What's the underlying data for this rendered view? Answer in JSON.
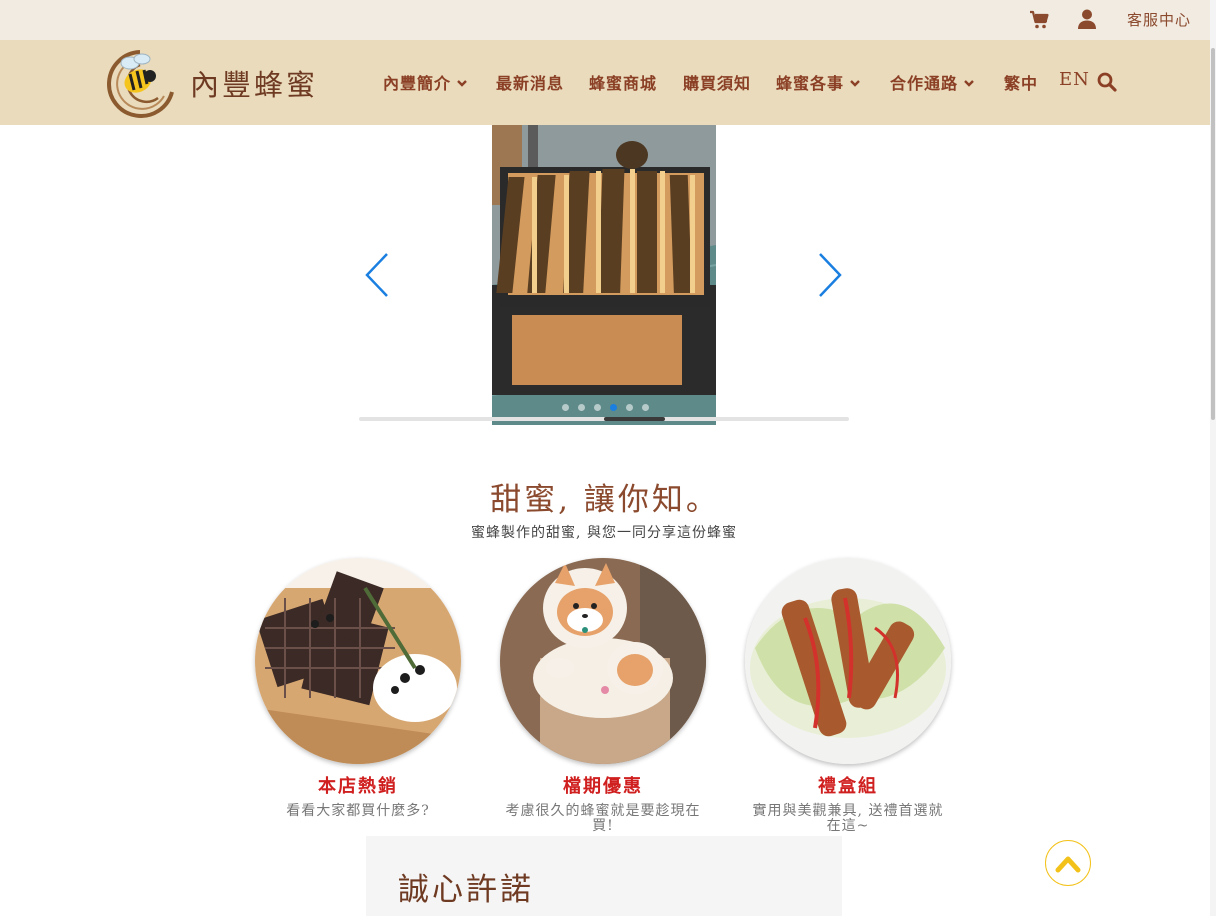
{
  "topbar": {
    "cart_icon": "shopping-cart-icon",
    "user_icon": "user-icon",
    "customer_service_label": "客服中心"
  },
  "brand": {
    "logo_icon": "bee-logo-icon",
    "name": "內豐蜂蜜"
  },
  "nav": {
    "items": [
      {
        "label": "內豐簡介",
        "has_dropdown": true
      },
      {
        "label": "最新消息",
        "has_dropdown": false
      },
      {
        "label": "蜂蜜商城",
        "has_dropdown": false
      },
      {
        "label": "購買須知",
        "has_dropdown": false
      },
      {
        "label": "蜂蜜各事",
        "has_dropdown": true
      },
      {
        "label": "合作通路",
        "has_dropdown": true
      },
      {
        "label": "繁中",
        "has_dropdown": false
      },
      {
        "label": "EN",
        "has_dropdown": false
      }
    ],
    "search_icon": "search-icon"
  },
  "carousel": {
    "slide_description": "beehive-frames-photo",
    "prev_icon": "chevron-left-icon",
    "next_icon": "chevron-right-icon",
    "slide_count": 6,
    "active_index": 3
  },
  "intro": {
    "title": "甜蜜, 讓你知。",
    "subtitle": "蜜蜂製作的甜蜜, 與您一同分享這份蜂蜜"
  },
  "features": [
    {
      "title": "本店熱銷",
      "description": "看看大家都買什麼多?"
    },
    {
      "title": "檔期優惠",
      "description": "考慮很久的蜂蜜就是要趁現在買!"
    },
    {
      "title": "禮盒組",
      "description": "實用與美觀兼具, 送禮首選就在這~"
    }
  ],
  "promise": {
    "title": "誠心許諾"
  },
  "back_to_top_icon": "chevron-up-icon",
  "colors": {
    "topbar_bg": "#f1ebe1",
    "nav_bg": "#e9dbbc",
    "brand_brown": "#8b4026",
    "feature_title_red": "#d01f1f",
    "carousel_arrow_blue": "#1a7fe0",
    "back_to_top_yellow": "#f3c21a"
  }
}
